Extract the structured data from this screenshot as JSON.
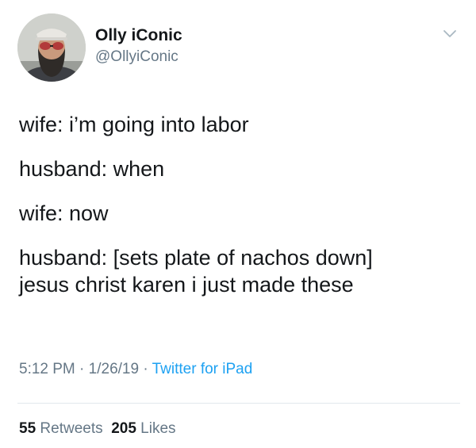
{
  "author": {
    "display_name": "Olly iConic",
    "handle": "@OllyiConic",
    "avatar_icon": "bearded-man-avatar"
  },
  "menu_icon": "chevron-down-icon",
  "tweet": {
    "lines": [
      "wife: i’m going into labor",
      "husband: when",
      "wife: now",
      "husband: [sets plate of nachos down]",
      "jesus christ karen i just made these"
    ]
  },
  "meta": {
    "time": "5:12 PM",
    "separator": " · ",
    "date": "1/26/19",
    "source": "Twitter for iPad"
  },
  "stats": {
    "retweets_count": "55",
    "retweets_label": "Retweets",
    "likes_count": "205",
    "likes_label": "Likes"
  },
  "colors": {
    "text": "#14171a",
    "secondary": "#657786",
    "link": "#1da1f2",
    "divider": "#e1e8ed"
  }
}
